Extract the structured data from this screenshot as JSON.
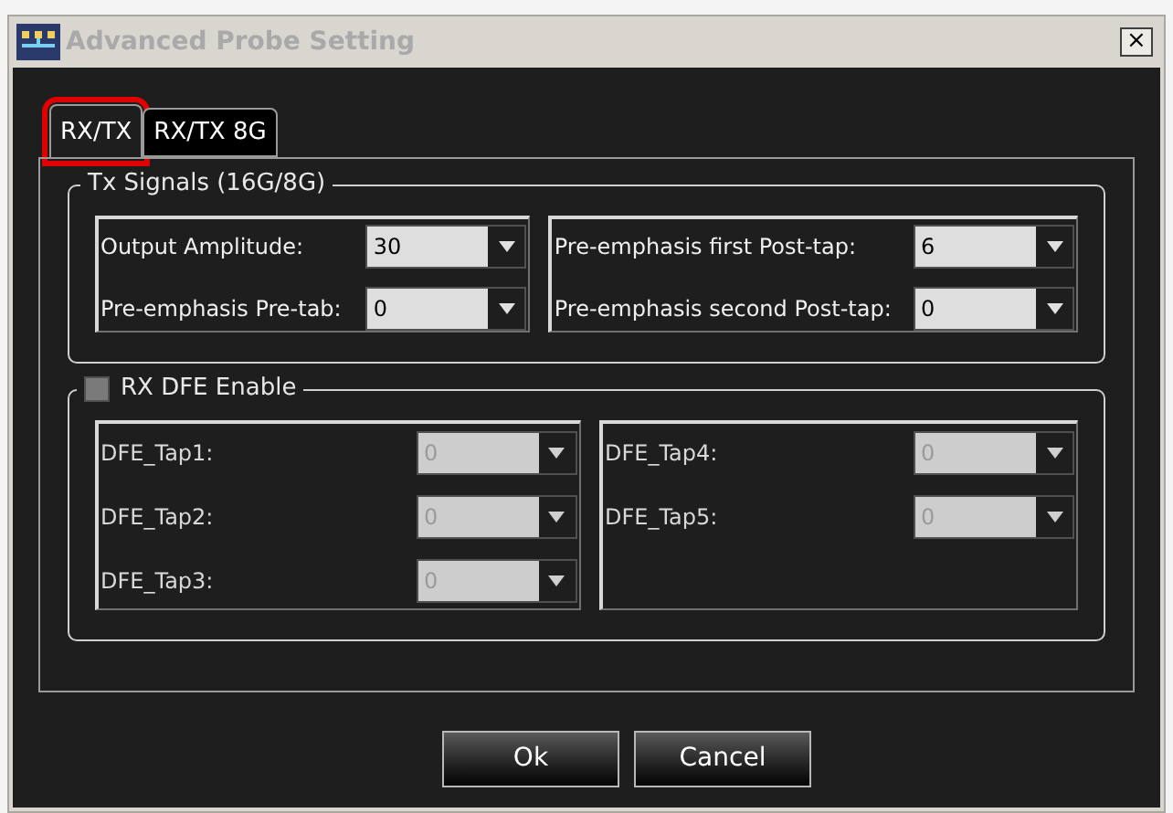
{
  "window": {
    "title": "Advanced Probe Setting",
    "close": "×"
  },
  "tabs": [
    {
      "label": "RX/TX",
      "selected": true,
      "highlighted": true
    },
    {
      "label": "RX/TX 8G",
      "selected": false,
      "highlighted": false
    }
  ],
  "tx_signals": {
    "title": "Tx Signals (16G/8G)",
    "columns": [
      [
        {
          "label": "Output Amplitude:",
          "value": "30",
          "disabled": false
        },
        {
          "label": "Pre-emphasis Pre-tab:",
          "value": "0",
          "disabled": false
        }
      ],
      [
        {
          "label": "Pre-emphasis first Post-tap:",
          "value": "6",
          "disabled": false
        },
        {
          "label": "Pre-emphasis second Post-tap:",
          "value": "0",
          "disabled": false
        }
      ]
    ]
  },
  "rx_dfe": {
    "title": "RX DFE Enable",
    "checked": false,
    "columns": [
      [
        {
          "label": "DFE_Tap1:",
          "value": "0",
          "disabled": true
        },
        {
          "label": "DFE_Tap2:",
          "value": "0",
          "disabled": true
        },
        {
          "label": "DFE_Tap3:",
          "value": "0",
          "disabled": true
        }
      ],
      [
        {
          "label": "DFE_Tap4:",
          "value": "0",
          "disabled": true
        },
        {
          "label": "DFE_Tap5:",
          "value": "0",
          "disabled": true
        }
      ]
    ]
  },
  "buttons": [
    "Ok",
    "Cancel"
  ]
}
